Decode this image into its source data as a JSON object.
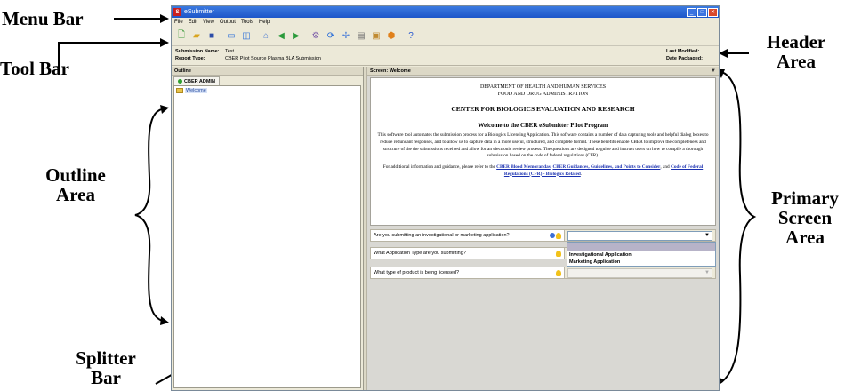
{
  "annotations": {
    "menu_bar": "Menu Bar",
    "tool_bar": "Tool Bar",
    "header_area_line1": "Header",
    "header_area_line2": "Area",
    "outline_area_line1": "Outline",
    "outline_area_line2": "Area",
    "splitter_bar_line1": "Splitter",
    "splitter_bar_line2": "Bar",
    "primary_area_line1": "Primary",
    "primary_area_line2": "Screen",
    "primary_area_line3": "Area"
  },
  "window": {
    "title": "eSubmitter",
    "logo": "S"
  },
  "menu": {
    "items": [
      "File",
      "Edit",
      "View",
      "Output",
      "Tools",
      "Help"
    ]
  },
  "toolbar": {
    "icons": [
      "new-document-icon",
      "open-folder-icon",
      "save-icon",
      "window-icon",
      "split-view-icon",
      "home-icon",
      "back-icon",
      "forward-icon",
      "settings-icon",
      "refresh-icon",
      "move-icon",
      "report-icon",
      "clipboard-icon",
      "stop-icon",
      "help-icon"
    ]
  },
  "header": {
    "submission_name_label": "Submission Name:",
    "submission_name_value": "Test",
    "report_type_label": "Report Type:",
    "report_type_value": "CBER Pilot  Source Plasma BLA Submission",
    "last_modified_label": "Last Modified:",
    "date_packaged_label": "Date Packaged:"
  },
  "outline": {
    "title": "Outline",
    "tab_label": "CBER ADMIN",
    "tree_item": "Welcome"
  },
  "primary": {
    "title": "Screen: Welcome",
    "dept_line1": "DEPARTMENT OF HEALTH AND HUMAN SERVICES",
    "dept_line2": "FOOD AND DRUG ADMINISTRATION",
    "center": "CENTER FOR BIOLOGICS EVALUATION AND RESEARCH",
    "heading": "Welcome to the CBER eSubmitter Pilot Program",
    "body": "This software tool automates the submission process for a Biologics Licensing Application. This software contains a number of data capturing tools and helpful dialog boxes to reduce redundant responses, and to allow us to capture data in a more useful, structured, and complete format. These benefits enable CBER to improve the completeness and structure of the the submissions received and allow for an electronic review process. The questions are designed to guide and instruct users on how to compile a thorough submission based on the code of federal regulations (CFR).",
    "info_prefix": "For additional information and guidance, please refer to the ",
    "link1": "CBER Blood Memorandas",
    "sep1": ", ",
    "link2": "CBER Guidances, Guidelines, and Points to Consider",
    "sep2": ", and ",
    "link3": "Code of Federal Regulations (CFR) - Biologics Related",
    "info_suffix": "."
  },
  "questions": [
    {
      "label": "Are you submitting an investigational or marketing application?",
      "value": ""
    },
    {
      "label": "What Application Type are you submitting?",
      "value": ""
    },
    {
      "label": "What type of product is being licensed?",
      "value": ""
    }
  ],
  "dropdown_options": [
    "Investigational Application",
    "Marketing Application"
  ]
}
